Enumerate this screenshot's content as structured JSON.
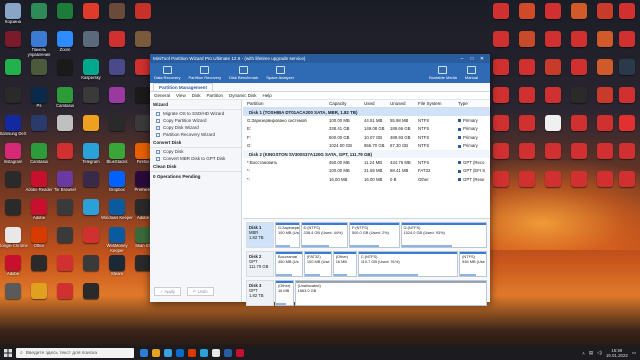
{
  "desktop_left": [
    {
      "label": "Корзина",
      "color": "#8aa4c8"
    },
    {
      "label": "",
      "color": "#2e8b57"
    },
    {
      "label": "",
      "color": "#1e7c3a"
    },
    {
      "label": "",
      "color": "#e03a2a"
    },
    {
      "label": "",
      "color": "#6a4a3a"
    },
    {
      "label": "",
      "color": "#c8302a"
    },
    {
      "label": "",
      "color": "#7a1a2a"
    },
    {
      "label": "Панель управления",
      "color": "#3c7bd4"
    },
    {
      "label": "Zoom",
      "color": "#2d8cff"
    },
    {
      "label": "",
      "color": "#5a6a7a"
    },
    {
      "label": "",
      "color": "#d03030"
    },
    {
      "label": "",
      "color": "#7a5a3a"
    },
    {
      "label": "",
      "color": "#22b14c"
    },
    {
      "label": "",
      "color": "#4a5a3a"
    },
    {
      "label": "",
      "color": "#1a1a1a"
    },
    {
      "label": "Kaspersky",
      "color": "#00a88e"
    },
    {
      "label": "",
      "color": "#4a4a8a"
    },
    {
      "label": "",
      "color": "#d03030"
    },
    {
      "label": "",
      "color": "#2a2a2a"
    },
    {
      "label": "Ps",
      "color": "#0a2a4a"
    },
    {
      "label": "Camtasia",
      "color": "#2e9b3a"
    },
    {
      "label": "",
      "color": "#3a3a3a"
    },
    {
      "label": "",
      "color": "#9a3aa0"
    },
    {
      "label": "",
      "color": "#1a1a1a"
    },
    {
      "label": "Samsung DeX",
      "color": "#1428a0"
    },
    {
      "label": "",
      "color": "#2a3a6a"
    },
    {
      "label": "",
      "color": "#c0c0c0"
    },
    {
      "label": "",
      "color": "#f0a020"
    },
    {
      "label": "",
      "color": "#2a2a2a"
    },
    {
      "label": "",
      "color": "#3a3a3a"
    },
    {
      "label": "Instagram",
      "color": "#d62976"
    },
    {
      "label": "Camtasia",
      "color": "#2e9b3a"
    },
    {
      "label": "",
      "color": "#d03030"
    },
    {
      "label": "Telegram",
      "color": "#2aa1d9"
    },
    {
      "label": "BlueStacks",
      "color": "#3aa63a"
    },
    {
      "label": "Firefox",
      "color": "#e66000"
    },
    {
      "label": "",
      "color": "#2a2a2a"
    },
    {
      "label": "Adobe Reader",
      "color": "#c8102e"
    },
    {
      "label": "Tor Browser",
      "color": "#6a3aa0"
    },
    {
      "label": "",
      "color": "#3a2a4a"
    },
    {
      "label": "Dropbox",
      "color": "#0061ff"
    },
    {
      "label": "Premiere",
      "color": "#2a0a3a"
    },
    {
      "label": "",
      "color": "#2a2a2a"
    },
    {
      "label": "Adobe",
      "color": "#c8102e"
    },
    {
      "label": "",
      "color": "#3a3a3a"
    },
    {
      "label": "",
      "color": "#2aa1d9"
    },
    {
      "label": "Windows Keeper",
      "color": "#0a5aa0"
    },
    {
      "label": "Adobe",
      "color": "#2a2a2a"
    },
    {
      "label": "Google Chrome",
      "color": "#e8e8e8"
    },
    {
      "label": "Office",
      "color": "#d83b01"
    },
    {
      "label": "",
      "color": "#3a3a3a"
    },
    {
      "label": "",
      "color": "#d03030"
    },
    {
      "label": "WebMoney Keeper",
      "color": "#0a5aa0"
    },
    {
      "label": "Skan Sb",
      "color": "#3a6a3a"
    },
    {
      "label": "Adobe",
      "color": "#c8102e"
    },
    {
      "label": "",
      "color": "#2a2a2a"
    },
    {
      "label": "",
      "color": "#d03030"
    },
    {
      "label": "",
      "color": "#3a3a3a"
    },
    {
      "label": "Steam",
      "color": "#1b2838"
    },
    {
      "label": "",
      "color": "#2a2a2a"
    },
    {
      "label": "",
      "color": "#5a5a5a"
    },
    {
      "label": "",
      "color": "#e0a020"
    },
    {
      "label": "",
      "color": "#d03030"
    },
    {
      "label": "",
      "color": "#2a2a2a"
    }
  ],
  "desktop_right": [
    {
      "label": "",
      "color": "#d03030"
    },
    {
      "label": "",
      "color": "#d04a2a"
    },
    {
      "label": "",
      "color": "#d03030"
    },
    {
      "label": "",
      "color": "#d05a2a"
    },
    {
      "label": "",
      "color": "#c83a2a"
    },
    {
      "label": "",
      "color": "#d03030"
    },
    {
      "label": "",
      "color": "#d03030"
    },
    {
      "label": "",
      "color": "#c84a2a"
    },
    {
      "label": "",
      "color": "#d03030"
    },
    {
      "label": "",
      "color": "#d03030"
    },
    {
      "label": "",
      "color": "#d05a2a"
    },
    {
      "label": "",
      "color": "#d03030"
    },
    {
      "label": "",
      "color": "#d03030"
    },
    {
      "label": "",
      "color": "#d03030"
    },
    {
      "label": "",
      "color": "#c83a2a"
    },
    {
      "label": "",
      "color": "#d03030"
    },
    {
      "label": "",
      "color": "#d05a2a"
    },
    {
      "label": "",
      "color": "#2a3a4a"
    },
    {
      "label": "",
      "color": "#d03030"
    },
    {
      "label": "",
      "color": "#d03030"
    },
    {
      "label": "",
      "color": "#d03030"
    },
    {
      "label": "",
      "color": "#2a2a2a"
    },
    {
      "label": "",
      "color": "#c83a2a"
    },
    {
      "label": "",
      "color": "#d03030"
    },
    {
      "label": "",
      "color": "#d03030"
    },
    {
      "label": "",
      "color": "#d03030"
    },
    {
      "label": "",
      "color": "#f0f0f0"
    },
    {
      "label": "",
      "color": "#d03030"
    },
    {
      "label": "",
      "color": "#d03030"
    },
    {
      "label": "",
      "color": "#e03030"
    },
    {
      "label": "",
      "color": "#d03030"
    },
    {
      "label": "",
      "color": "#d03030"
    },
    {
      "label": "",
      "color": "#d03030"
    },
    {
      "label": "",
      "color": "#d03030"
    },
    {
      "label": "",
      "color": "#d03030"
    },
    {
      "label": "",
      "color": "#d03030"
    },
    {
      "label": "",
      "color": "#d03030"
    },
    {
      "label": "",
      "color": "#d03030"
    },
    {
      "label": "",
      "color": "#d03030"
    },
    {
      "label": "",
      "color": "#d03030"
    },
    {
      "label": "",
      "color": "#d03030"
    },
    {
      "label": "",
      "color": "#d03030"
    }
  ],
  "window": {
    "title": "MiniTool Partition Wizard Pro Ultimate 12.6 - (with lifetime upgrade service)",
    "ribbon": [
      "Data Recovery",
      "Partition Recovery",
      "Disk Benchmark",
      "Space Analyzer"
    ],
    "ribbon_right": [
      "Bootable Media",
      "Manual"
    ],
    "tab": "Partition Management",
    "menu": [
      "General",
      "View",
      "Disk",
      "Partition",
      "Dynamic Disk",
      "Help"
    ]
  },
  "sidebar": {
    "wizard_title": "Wizard",
    "wizard_items": [
      "Migrate OS to SSD/HD Wizard",
      "Copy Partition Wizard",
      "Copy Disk Wizard",
      "Partition Recovery Wizard"
    ],
    "convert_title": "Convert Disk",
    "convert_items": [
      "Copy Disk",
      "Convert MBR Disk to GPT Disk"
    ],
    "clean_title": "Clean Disk",
    "pending": "0 Operations Pending",
    "apply": "Apply",
    "undo": "Undo"
  },
  "table": {
    "headers": [
      "Partition",
      "Capacity",
      "Used",
      "Unused",
      "File System",
      "Type"
    ],
    "disk1": "Disk 1 (TOSHIBA DT01ACA200 SATA, MBR, 1.82 TB)",
    "disk1_rows": [
      [
        "G:Зарезервировано системой",
        "100.00 MB",
        "44.51 MB",
        "55.98 MB",
        "NTFS",
        "Primary"
      ],
      [
        "E:",
        "338.41 GB",
        "149.08 GB",
        "189.66 GB",
        "NTFS",
        "Primary"
      ],
      [
        "F:",
        "500.00 GB",
        "10.07 GB",
        "489.93 GB",
        "NTFS",
        "Primary"
      ],
      [
        "G:",
        "1024.00 GB",
        "956.70 GB",
        "67.30 GB",
        "NTFS",
        "Primary"
      ]
    ],
    "disk2": "Disk 2 (KINGSTON SV300S37A120G SATA, GPT, 111.79 GB)",
    "disk2_rows": [
      [
        "*:Восстановить",
        "450.00 MB",
        "11.24 MB",
        "434.76 MB",
        "NTFS",
        "GPT (Reco"
      ],
      [
        "*:",
        "100.00 MB",
        "31.59 MB",
        "68.41 MB",
        "FAT32",
        "GPT (EFI S"
      ],
      [
        "*:",
        "16.00 MB",
        "16.00 MB",
        "0 B",
        "Other",
        "GPT (Rese"
      ]
    ]
  },
  "diskmap": [
    {
      "name": "Disk 1",
      "info": "MBR\n1.82 TB",
      "parts": [
        {
          "l1": "G:Зарезерв",
          "l2": "100 MB (Use",
          "w": 12,
          "un": false
        },
        {
          "l1": "E:(NTFS)",
          "l2": "338.4 GB (Used: 44%)",
          "w": 26,
          "un": false
        },
        {
          "l1": "F:(NTFS)",
          "l2": "500.0 GB (Used: 2%)",
          "w": 28,
          "un": false
        },
        {
          "l1": "G:(NTFS)",
          "l2": "1024.0 GB (Used: 93%)",
          "w": 50,
          "un": false
        }
      ]
    },
    {
      "name": "Disk 2",
      "info": "GPT\n111.79 GB",
      "parts": [
        {
          "l1": "Восстанов",
          "l2": "450 MB (Us",
          "w": 12,
          "un": false
        },
        {
          "l1": "(FAT32)",
          "l2": "100 MB (Use",
          "w": 12,
          "un": false
        },
        {
          "l1": "(Other)",
          "l2": "16 MB",
          "w": 10,
          "un": false
        },
        {
          "l1": "C:(NTFS)",
          "l2": "110.7 GB (Used: 91%)",
          "w": 50,
          "un": false
        },
        {
          "l1": "(NTFS)",
          "l2": "536 MB (Use",
          "w": 12,
          "un": false
        }
      ]
    },
    {
      "name": "Disk 3",
      "info": "GPT\n1.82 TB",
      "parts": [
        {
          "l1": "(Other)",
          "l2": "16 MB",
          "w": 8,
          "un": false
        },
        {
          "l1": "(Unallocated)",
          "l2": "1863.0 GB",
          "w": 110,
          "un": true
        }
      ]
    }
  ],
  "taskbar": {
    "search_placeholder": "Введите здесь текст для поиска",
    "time": "15:59",
    "date": "19.01.2022",
    "apps": [
      "#2d7cd6",
      "#e8a020",
      "#3aa0e0",
      "#0a6ad0",
      "#d83b01",
      "#2aa1d9",
      "#e8e8e8",
      "#2a5d9e",
      "#c8102e"
    ]
  }
}
